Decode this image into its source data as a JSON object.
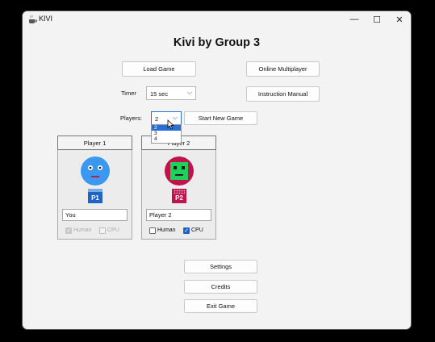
{
  "window": {
    "title": "KIVI",
    "controls": {
      "minimize": "—",
      "maximize": "☐",
      "close": "✕"
    }
  },
  "heading": "Kivi by Group 3",
  "buttons": {
    "load_game": "Load Game",
    "online_multiplayer": "Online Multiplayer",
    "instruction_manual": "Instruction Manual",
    "start_new_game": "Start New Game",
    "settings": "Settings",
    "credits": "Credits",
    "exit_game": "Exit Game"
  },
  "timer": {
    "label": "Timer",
    "value": "15 sec"
  },
  "players": {
    "label": "Players:",
    "value": "2",
    "options": [
      "2",
      "3",
      "4"
    ],
    "highlighted_option": "2",
    "dropdown_open": true
  },
  "player_panels": [
    {
      "header": "Player 1",
      "badge": "P1",
      "name_value": "You",
      "human_label": "Human",
      "cpu_label": "CPU",
      "human_checked": true,
      "cpu_checked": false,
      "disabled": true,
      "avatar_color": "#3b98f0",
      "badge_color": "#1f63c5"
    },
    {
      "header": "Player 2",
      "badge": "P2",
      "name_value": "Player 2",
      "human_label": "Human",
      "cpu_label": "CPU",
      "human_checked": false,
      "cpu_checked": true,
      "disabled": false,
      "avatar_color": "#c0134d",
      "avatar_face_color": "#1fd15a",
      "badge_color": "#c0134d"
    }
  ]
}
